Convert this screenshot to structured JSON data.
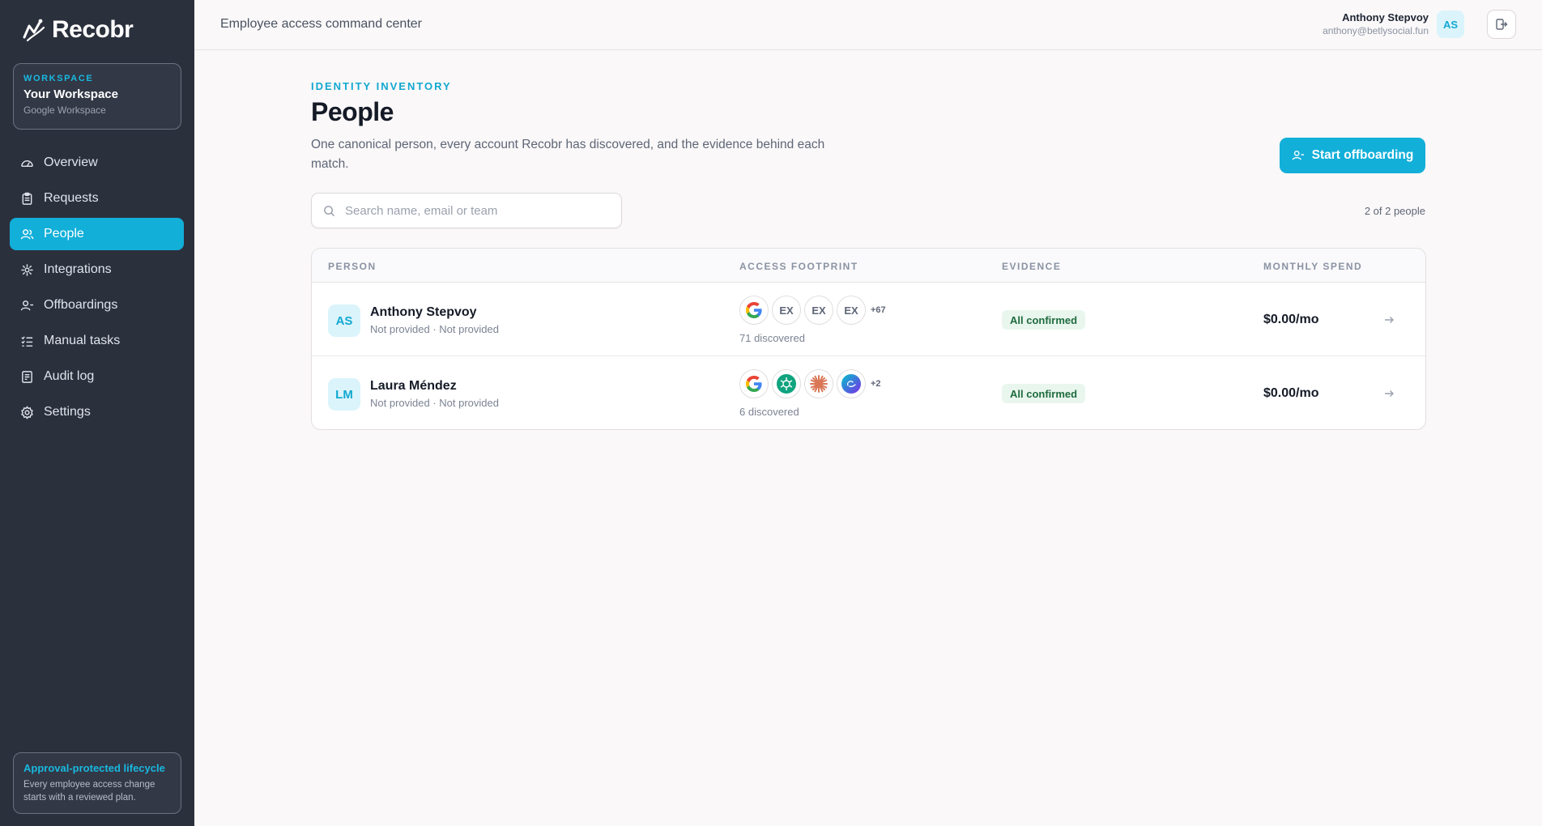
{
  "brand": {
    "name": "Recobr"
  },
  "workspace": {
    "kicker": "WORKSPACE",
    "name": "Your Workspace",
    "provider": "Google Workspace"
  },
  "nav": {
    "items": [
      {
        "label": "Overview",
        "icon": "gauge-icon",
        "active": false
      },
      {
        "label": "Requests",
        "icon": "clipboard-icon",
        "active": false
      },
      {
        "label": "People",
        "icon": "users-icon",
        "active": true
      },
      {
        "label": "Integrations",
        "icon": "plug-icon",
        "active": false
      },
      {
        "label": "Offboardings",
        "icon": "user-minus-icon",
        "active": false
      },
      {
        "label": "Manual tasks",
        "icon": "list-check-icon",
        "active": false
      },
      {
        "label": "Audit log",
        "icon": "log-icon",
        "active": false
      },
      {
        "label": "Settings",
        "icon": "gear-icon",
        "active": false
      }
    ]
  },
  "promo": {
    "title": "Approval-protected lifecycle",
    "text": "Every employee access change starts with a reviewed plan."
  },
  "topbar": {
    "title": "Employee access command center",
    "user_name": "Anthony Stepvoy",
    "user_email": "anthony@betlysocial.fun",
    "user_initials": "AS"
  },
  "page": {
    "kicker": "IDENTITY INVENTORY",
    "title": "People",
    "description": "One canonical person, every account Recobr has discovered, and the evidence behind each match.",
    "cta_label": "Start offboarding",
    "search_placeholder": "Search name, email or team",
    "count": "2 of 2 people"
  },
  "table": {
    "headers": {
      "person": "PERSON",
      "access": "ACCESS FOOTPRINT",
      "evidence": "EVIDENCE",
      "spend": "MONTHLY SPEND"
    },
    "rows": [
      {
        "initials": "AS",
        "name": "Anthony Stepvoy",
        "subtitle": "Not provided · Not provided",
        "apps": [
          "google-icon",
          "EX",
          "EX",
          "EX"
        ],
        "app_labels": {
          "a1": "EX",
          "a2": "EX",
          "a3": "EX"
        },
        "more": "+67",
        "discovered": "71 discovered",
        "evidence": "All confirmed",
        "spend": "$0.00/mo"
      },
      {
        "initials": "LM",
        "name": "Laura Méndez",
        "subtitle": "Not provided · Not provided",
        "apps": [
          "google-icon",
          "openai-icon",
          "claude-icon",
          "canva-icon"
        ],
        "more": "+2",
        "discovered": "6 discovered",
        "evidence": "All confirmed",
        "spend": "$0.00/mo"
      }
    ]
  },
  "colors": {
    "accent": "#12afd9",
    "sidebar": "#2b303d",
    "badge_bg": "#e9f6ee",
    "badge_text": "#1e6b3d"
  }
}
